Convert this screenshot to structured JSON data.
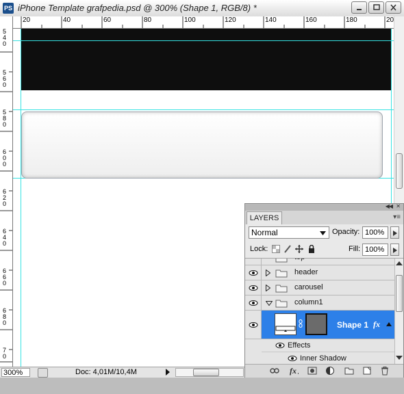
{
  "window": {
    "app_icon": "PS",
    "title": "iPhone Template grafpedia.psd @ 300% (Shape 1, RGB/8) *",
    "buttons": [
      "minimize-icon",
      "maximize-icon",
      "close-icon"
    ]
  },
  "rulers": {
    "top": [
      "20",
      "40",
      "60",
      "80",
      "100",
      "120",
      "140",
      "160",
      "180",
      "20"
    ],
    "left": [
      "540",
      "560",
      "580",
      "600",
      "620",
      "640",
      "660",
      "680",
      "70"
    ]
  },
  "status": {
    "zoom": "300%",
    "doc": "Doc: 4,01M/10,4M"
  },
  "layers_panel": {
    "tab": "LAYERS",
    "blend_mode": "Normal",
    "opacity_label": "Opacity:",
    "opacity_value": "100%",
    "lock_label": "Lock:",
    "fill_label": "Fill:",
    "fill_value": "100%",
    "layers": [
      {
        "name": "top",
        "type": "group",
        "visible": true,
        "expanded": false
      },
      {
        "name": "header",
        "type": "group",
        "visible": true,
        "expanded": false
      },
      {
        "name": "carousel",
        "type": "group",
        "visible": true,
        "expanded": false
      },
      {
        "name": "column1",
        "type": "group",
        "visible": true,
        "expanded": true
      },
      {
        "name": "Shape 1",
        "type": "shape",
        "visible": true,
        "selected": true,
        "fx": "fx"
      }
    ],
    "effects_label": "Effects",
    "inner_shadow_label": "Inner Shadow",
    "bottom_icons": [
      "link-layers-icon",
      "fx-icon",
      "mask-icon",
      "adjustment-icon",
      "new-group-icon",
      "new-layer-icon",
      "trash-icon"
    ]
  },
  "colors": {
    "selection": "#2d80e8",
    "guide": "#35e3e3",
    "band": "#0e0e0e"
  }
}
